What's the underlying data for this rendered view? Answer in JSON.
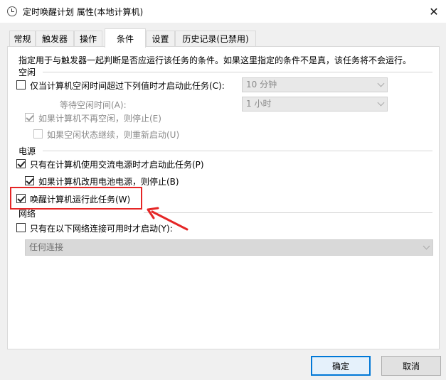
{
  "window": {
    "title": "定时唤醒计划 属性(本地计算机)",
    "close_glyph": "✕"
  },
  "tabs": [
    {
      "label": "常规",
      "active": false
    },
    {
      "label": "触发器",
      "active": false
    },
    {
      "label": "操作",
      "active": false
    },
    {
      "label": "条件",
      "active": true
    },
    {
      "label": "设置",
      "active": false
    },
    {
      "label": "历史记录(已禁用)",
      "active": false
    }
  ],
  "conditions": {
    "description": "指定用于与触发器一起判断是否应运行该任务的条件。如果这里指定的条件不是真，该任务将不会运行。",
    "idle": {
      "group_label": "空闲",
      "start_if_idle": {
        "label": "仅当计算机空闲时间超过下列值时才启动此任务(C):",
        "checked": false
      },
      "idle_duration": {
        "value": "10 分钟"
      },
      "wait_label": "等待空闲时间(A):",
      "wait_duration": {
        "value": "1 小时"
      },
      "stop_if_not_idle": {
        "label": "如果计算机不再空闲，则停止(E)",
        "checked": true
      },
      "restart_if_idle": {
        "label": "如果空闲状态继续，则重新启动(U)",
        "checked": false
      }
    },
    "power": {
      "group_label": "电源",
      "ac_only": {
        "label": "只有在计算机使用交流电源时才启动此任务(P)",
        "checked": true
      },
      "stop_on_battery": {
        "label": "如果计算机改用电池电源，则停止(B)",
        "checked": true
      },
      "wake_to_run": {
        "label": "唤醒计算机运行此任务(W)",
        "checked": true
      }
    },
    "network": {
      "group_label": "网络",
      "network_only": {
        "label": "只有在以下网络连接可用时才启动(Y):",
        "checked": false
      },
      "connection": {
        "value": "任何连接"
      }
    }
  },
  "annotation": {
    "color": "#e52626"
  },
  "buttons": {
    "ok": "确定",
    "cancel": "取消"
  }
}
